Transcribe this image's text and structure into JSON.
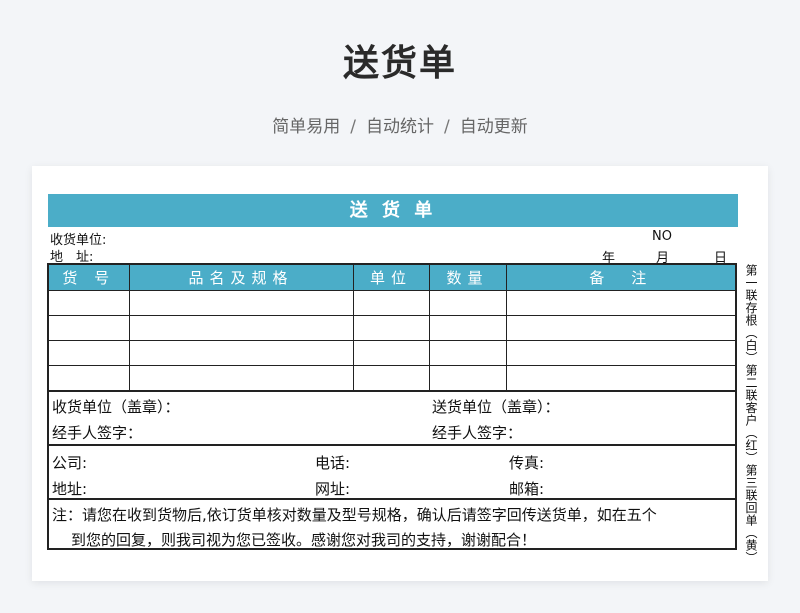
{
  "header": {
    "title": "送货单",
    "tags": [
      "简单易用",
      "自动统计",
      "自动更新"
    ],
    "separator": "/"
  },
  "form": {
    "banner": "送 货 单",
    "receiver_label": "收货单位:",
    "address_label": "地　址:",
    "no_label": "NO",
    "year_label": "年",
    "month_label": "月",
    "day_label": "日",
    "columns": [
      "货 号",
      "品名及规格",
      "单位",
      "数量",
      "备　注"
    ],
    "row_count": 4,
    "receiver_seal": "收货单位（盖章）：",
    "sender_seal": "送货单位（盖章）：",
    "handler_sign_left": "经手人签字：",
    "handler_sign_right": "经手人签字：",
    "company_label": "公司:",
    "phone_label": "电话:",
    "fax_label": "传真:",
    "addr2_label": "地址:",
    "web_label": "网址:",
    "mail_label": "邮箱:",
    "note_line1": "注：请您在收到货物后,依订货单核对数量及型号规格，确认后请签字回传送货单，如在五个",
    "note_line2": "到您的回复，则我司视为您已签收。感谢您对我司的支持，谢谢配合！",
    "side_note": "第一联存根（白）第二联客户（红）第三联回单（黄）"
  }
}
